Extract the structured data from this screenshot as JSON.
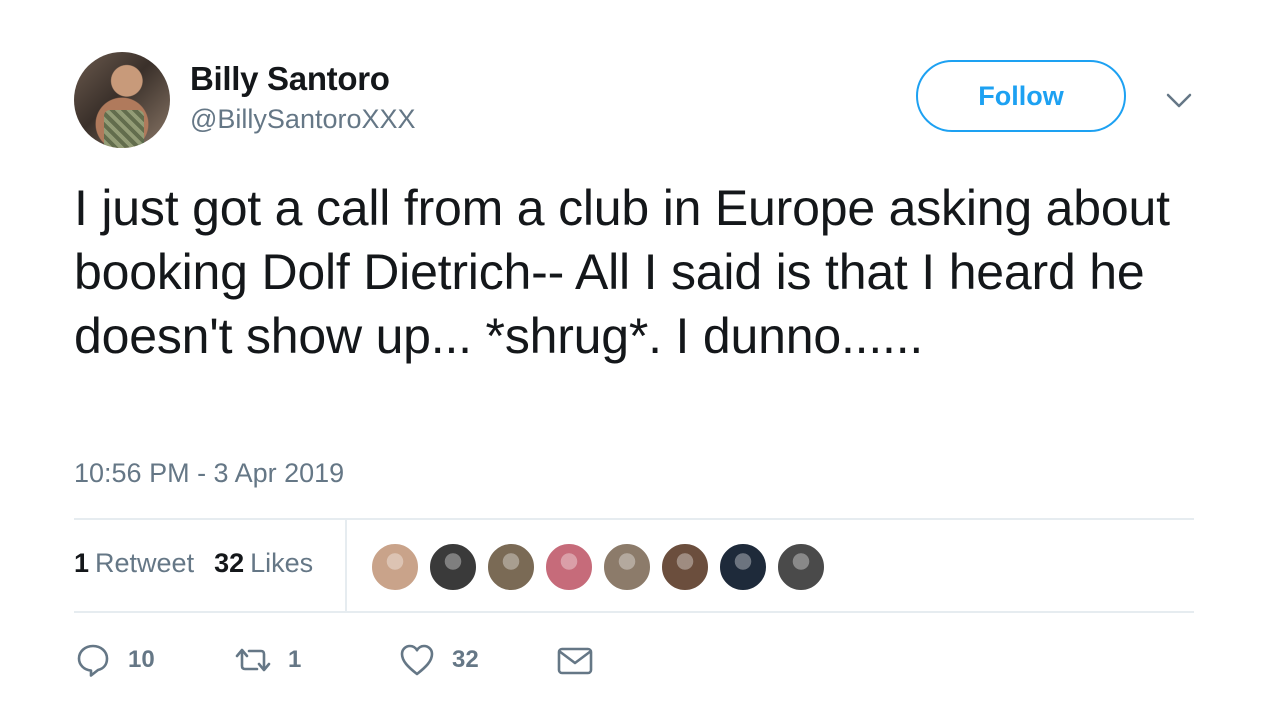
{
  "author": {
    "name": "Billy Santoro",
    "handle": "@BillySantoroXXX"
  },
  "follow_label": "Follow",
  "tweet": {
    "text": "I just got a call from a club in Europe asking about booking Dolf Dietrich-- All I said is that I heard he doesn't show up... *shrug*. I dunno......",
    "timestamp": "10:56 PM - 3 Apr 2019"
  },
  "stats": {
    "retweets_count": "1",
    "retweets_label": "Retweet",
    "likes_count": "32",
    "likes_label": "Likes"
  },
  "likers": [
    "#c9a38a",
    "#3a3a3a",
    "#7a6a55",
    "#c66b7a",
    "#8c7b6a",
    "#6b4e3d",
    "#1e2a3a",
    "#4a4a4a"
  ],
  "actions": {
    "replies": "10",
    "retweets": "1",
    "likes": "32"
  },
  "icons": {
    "reply": "reply-icon",
    "retweet": "retweet-icon",
    "like": "heart-icon",
    "dm": "envelope-icon",
    "more": "chevron-down-icon"
  },
  "colors": {
    "accent": "#1da1f2",
    "secondary_text": "#657786",
    "primary_text": "#14171a"
  }
}
